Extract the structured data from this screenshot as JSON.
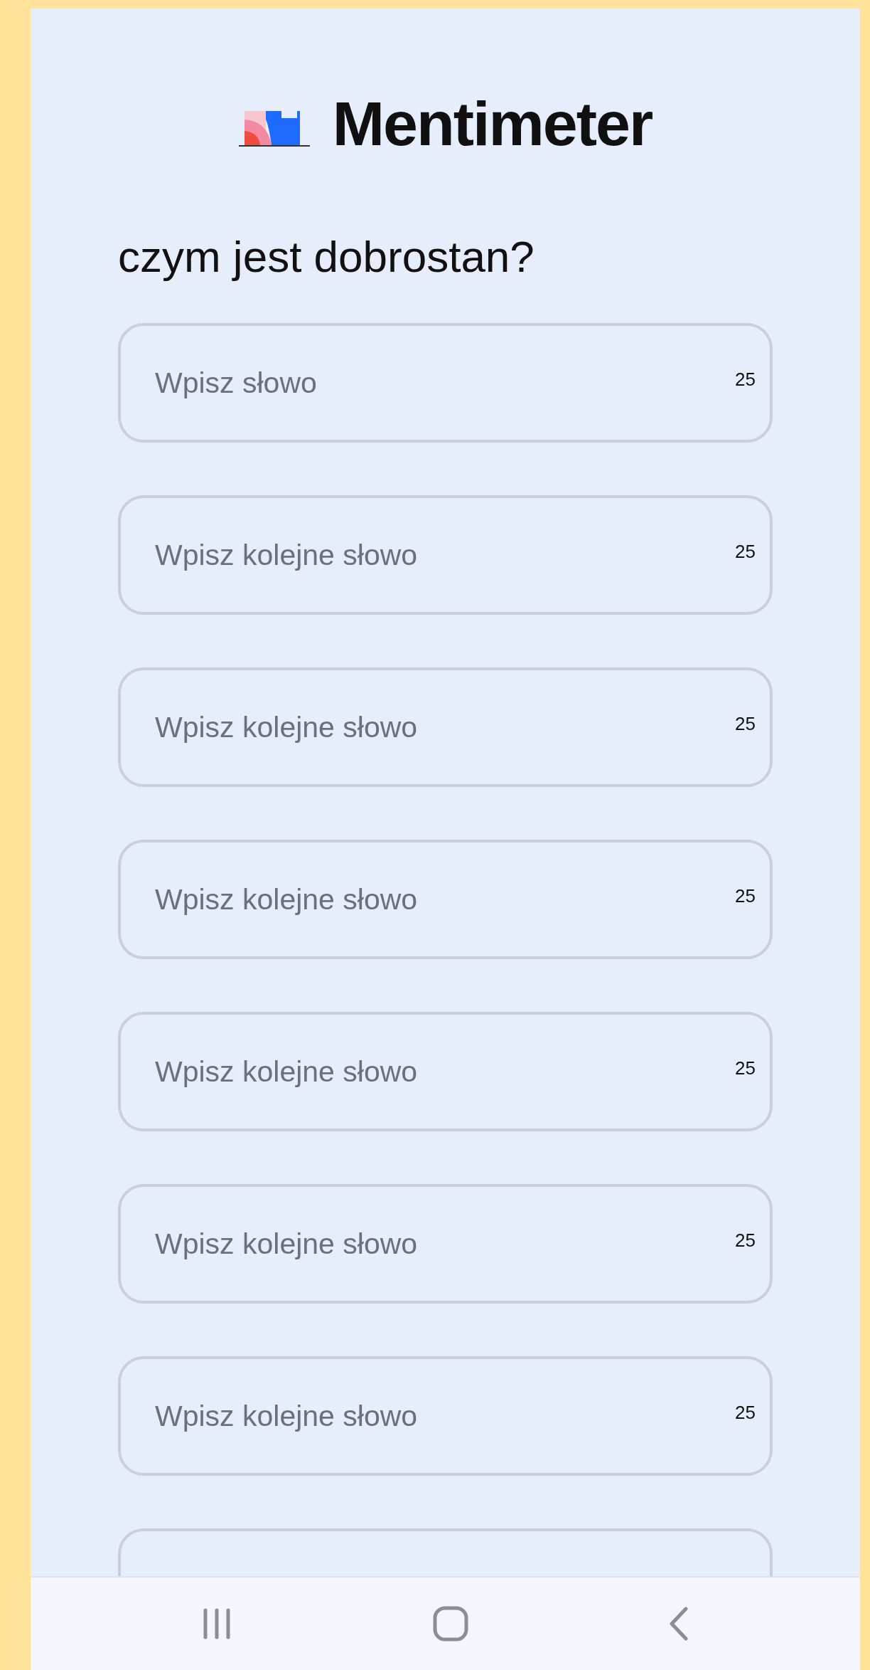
{
  "brand": {
    "name": "Mentimeter"
  },
  "question": "czym jest dobrostan?",
  "fields": [
    {
      "kind": "full",
      "placeholder": "Wpisz słowo",
      "counter": "25"
    },
    {
      "kind": "full",
      "placeholder": "Wpisz kolejne słowo",
      "counter": "25"
    },
    {
      "kind": "full",
      "placeholder": "Wpisz kolejne słowo",
      "counter": "25"
    },
    {
      "kind": "full",
      "placeholder": "Wpisz kolejne słowo",
      "counter": "25"
    },
    {
      "kind": "full",
      "placeholder": "Wpisz kolejne słowo",
      "counter": "25"
    },
    {
      "kind": "full",
      "placeholder": "Wpisz kolejne słowo",
      "counter": "25"
    },
    {
      "kind": "full",
      "placeholder": "Wpisz kolejne słowo",
      "counter": "25"
    },
    {
      "kind": "partial"
    }
  ]
}
